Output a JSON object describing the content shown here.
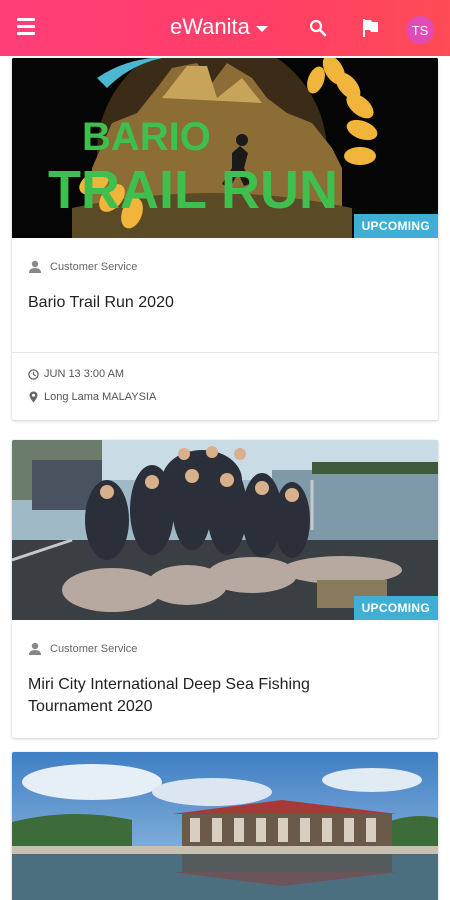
{
  "app": {
    "brand": "eWanita",
    "avatar_initials": "TS",
    "colors": {
      "header_start": "#ff3e79",
      "header_end": "#ff4b55",
      "badge": "#3fb0d3"
    }
  },
  "icons": {
    "menu": "menu-icon",
    "search": "search-icon",
    "flag": "flag-icon",
    "user": "user-icon",
    "clock": "clock-icon",
    "location": "location-pin-icon"
  },
  "events": [
    {
      "banner_text_top": "BARIO",
      "banner_text_main": "TRAIL RUN",
      "status": "UPCOMING",
      "organizer": "Customer Service",
      "title": "Bario Trail Run 2020",
      "datetime": "JUN 13 3:00 AM",
      "location": "Long Lama MALAYSIA"
    },
    {
      "status": "UPCOMING",
      "organizer": "Customer Service",
      "title_line1": "Miri City International Deep Sea Fishing",
      "title_line2": "Tournament 2020"
    },
    {}
  ]
}
